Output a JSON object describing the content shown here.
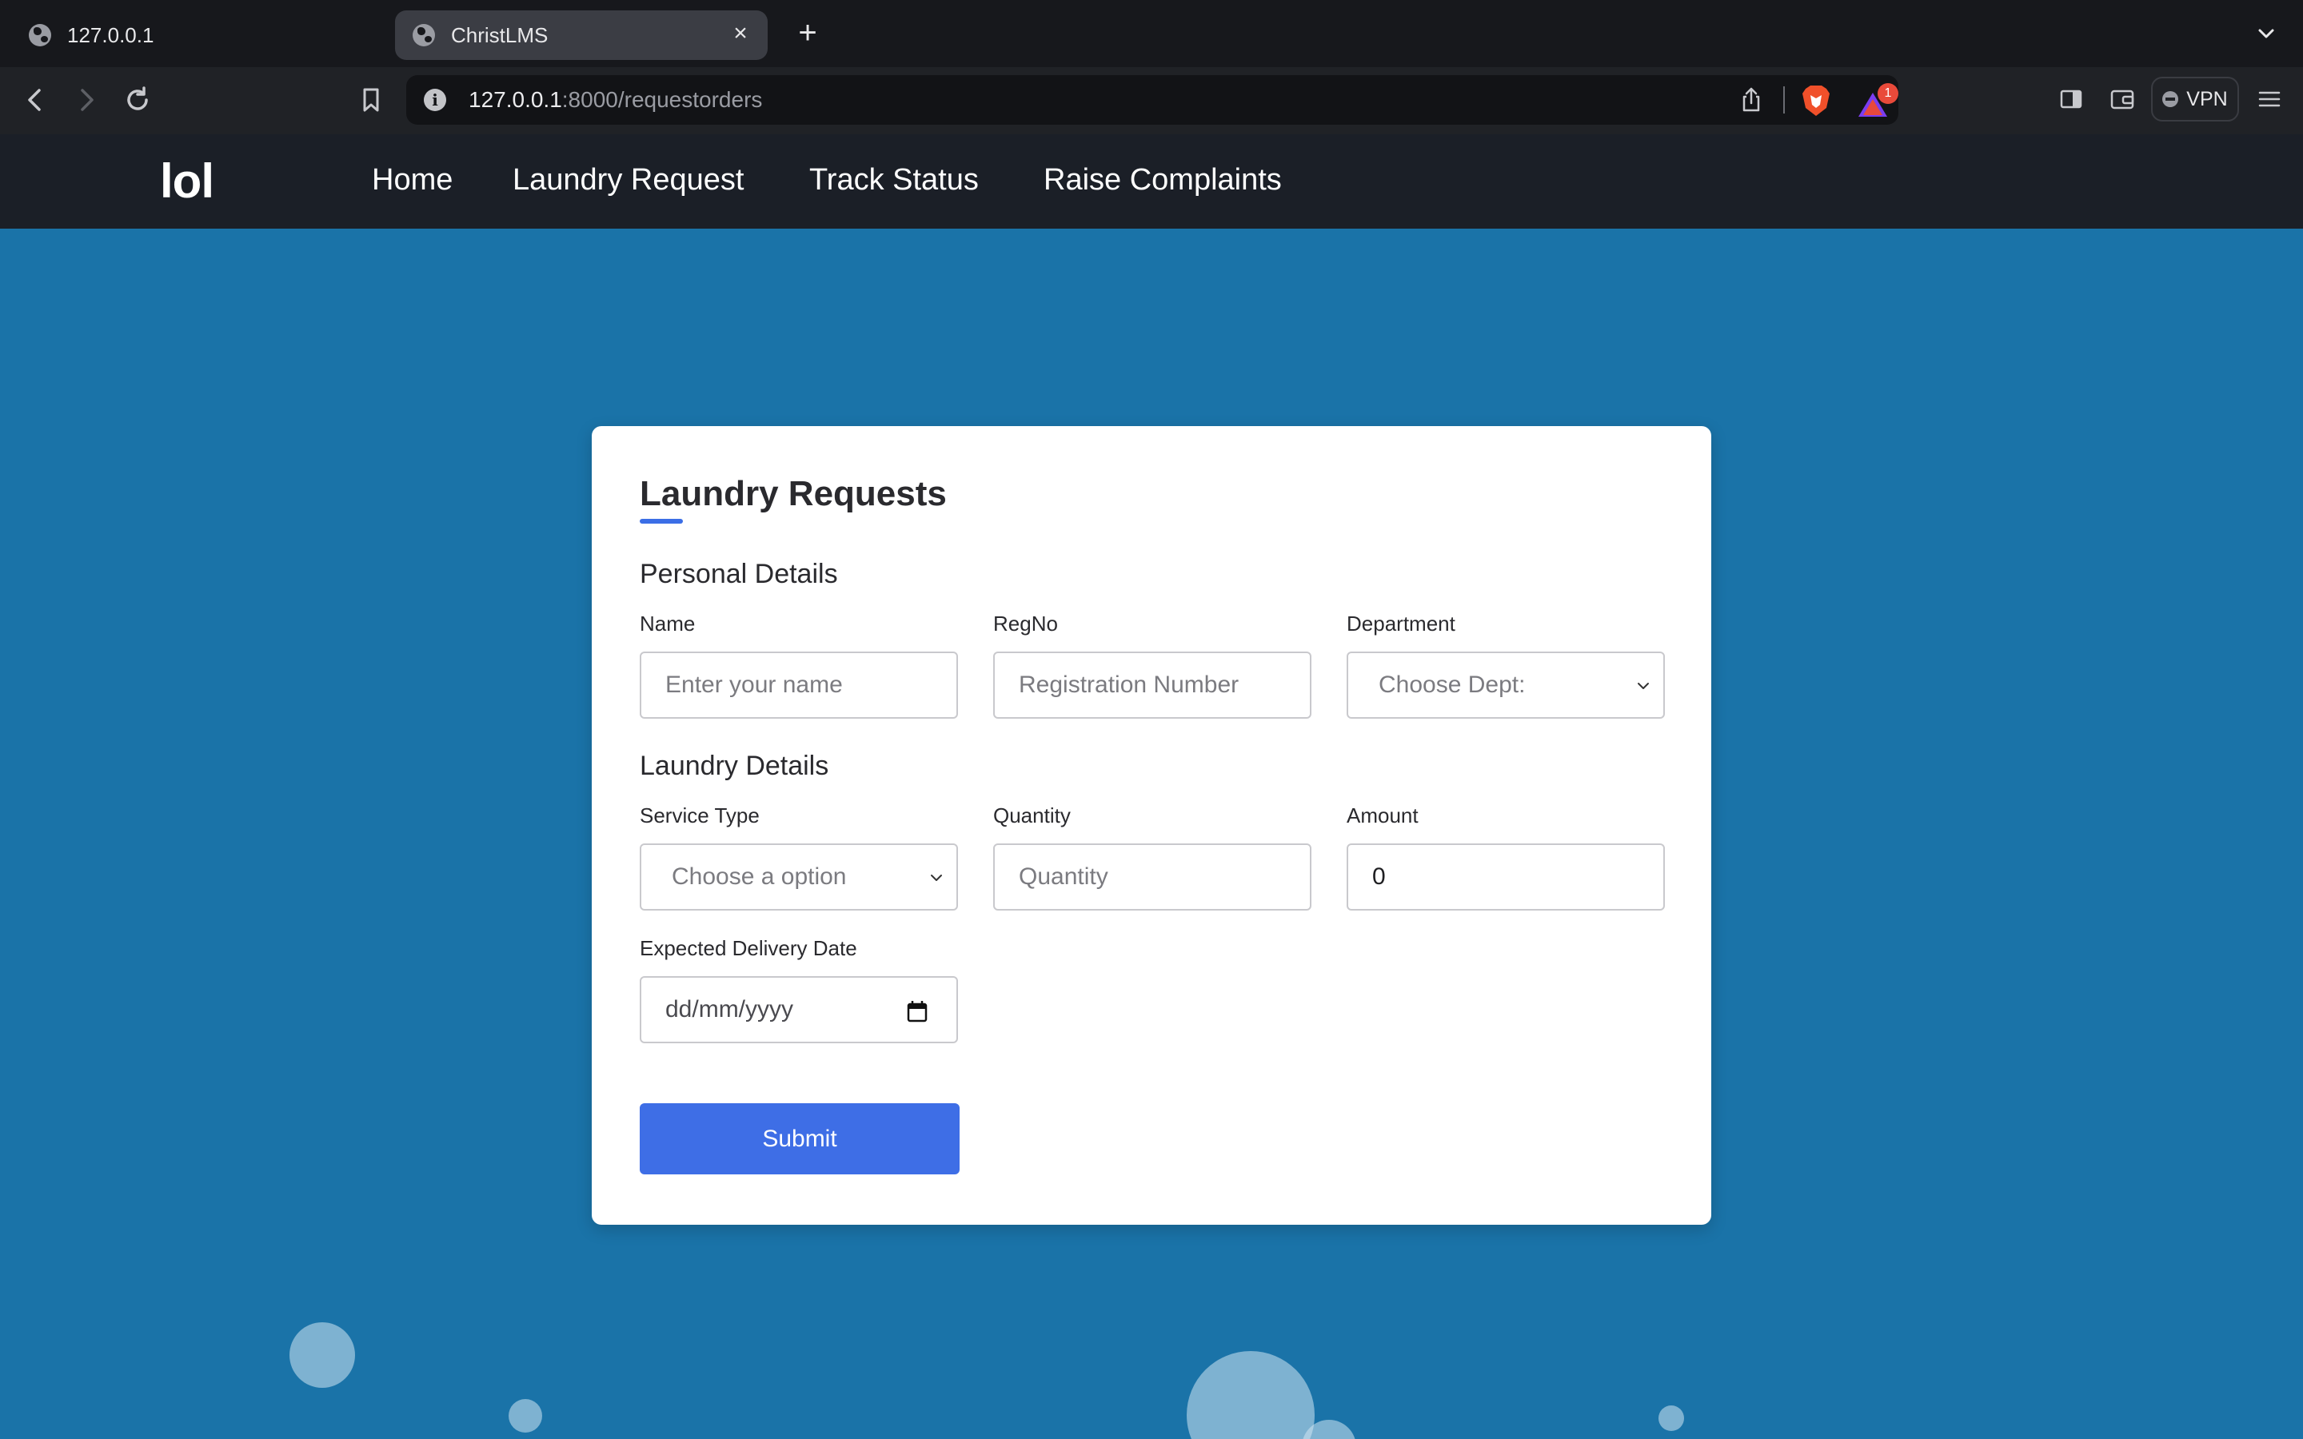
{
  "browser": {
    "tabs": [
      {
        "label": "127.0.0.1",
        "active": false
      },
      {
        "label": "ChristLMS",
        "active": true
      }
    ],
    "url": {
      "host": "127.0.0.1",
      "rest": ":8000/requestorders"
    },
    "rewards_badge": "1",
    "vpn_label": "VPN"
  },
  "site": {
    "logo": "lol",
    "nav": [
      "Home",
      "Laundry Request",
      "Track Status",
      "Raise Complaints"
    ]
  },
  "form": {
    "title": "Laundry Requests",
    "personal_section": "Personal Details",
    "laundry_section": "Laundry Details",
    "name": {
      "label": "Name",
      "placeholder": "Enter your name"
    },
    "regno": {
      "label": "RegNo",
      "placeholder": "Registration Number"
    },
    "department": {
      "label": "Department",
      "selected": "Choose Dept:"
    },
    "service_type": {
      "label": "Service Type",
      "selected": "Choose a option"
    },
    "quantity": {
      "label": "Quantity",
      "placeholder": "Quantity"
    },
    "amount": {
      "label": "Amount",
      "value": "0"
    },
    "delivery_date": {
      "label": "Expected Delivery Date",
      "placeholder": "dd/mm/yyyy"
    },
    "submit_label": "Submit"
  },
  "colors": {
    "page_bg": "#1a73a8",
    "nav_bg": "#1b1f27",
    "accent": "#3e6ee6"
  }
}
